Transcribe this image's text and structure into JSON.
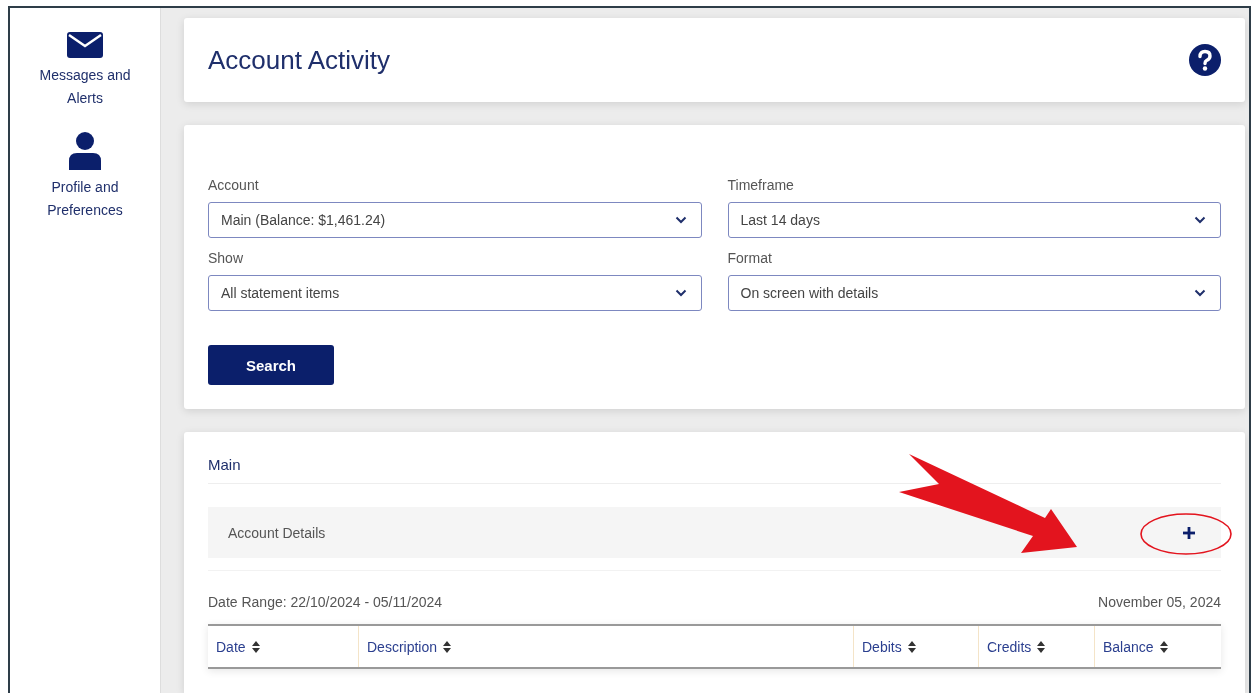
{
  "sidebar": {
    "items": [
      {
        "kind": "messages",
        "label": "Messages and Alerts"
      },
      {
        "kind": "profile",
        "label": "Profile and Preferences"
      }
    ]
  },
  "header": {
    "title": "Account Activity"
  },
  "filters": {
    "fields": [
      {
        "label": "Account",
        "value": "Main (Balance: $1,461.24)"
      },
      {
        "label": "Timeframe",
        "value": "Last 14 days"
      },
      {
        "label": "Show",
        "value": "All statement items"
      },
      {
        "label": "Format",
        "value": "On screen with details"
      }
    ],
    "search_button": "Search"
  },
  "results": {
    "account_name": "Main",
    "details_label": "Account Details",
    "details_expanded": false,
    "date_range": "Date Range: 22/10/2024 - 05/11/2024",
    "date": "November 05, 2024",
    "table": {
      "columns": [
        "Date",
        "Description",
        "Debits",
        "Credits",
        "Balance"
      ]
    }
  }
}
